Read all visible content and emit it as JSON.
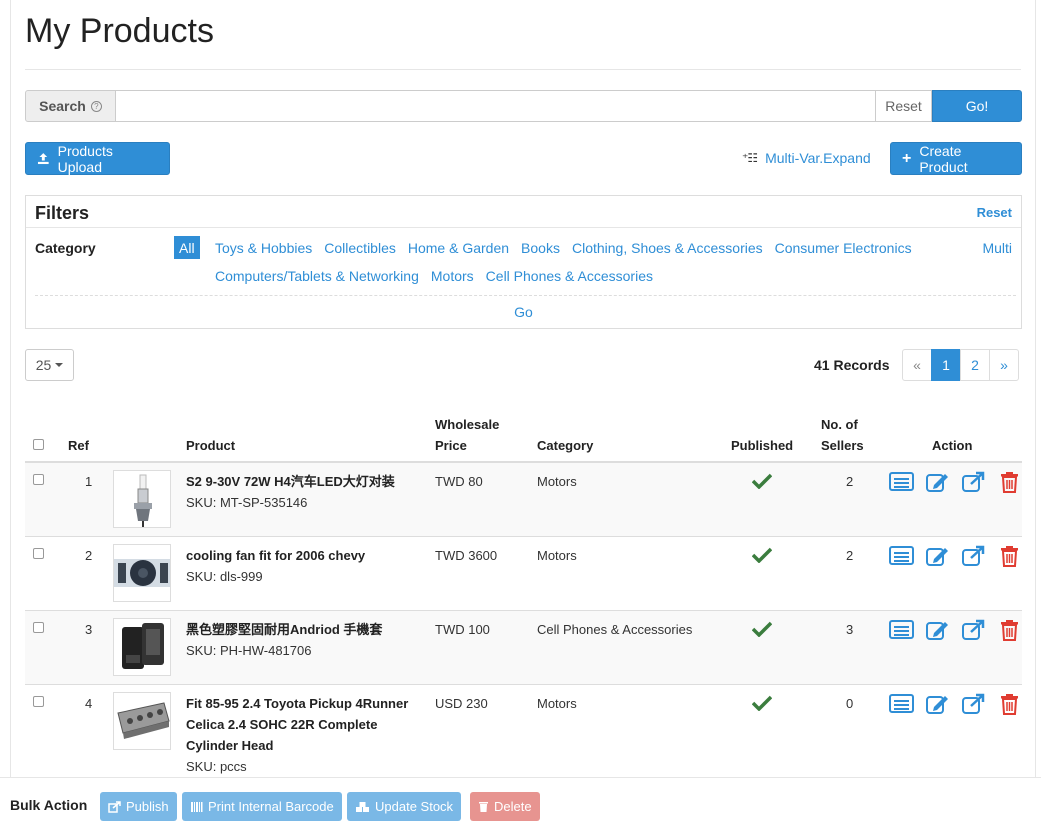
{
  "page": {
    "title": "My Products"
  },
  "search": {
    "label": "Search",
    "help_icon": "question-circle-icon",
    "value": "",
    "placeholder": "",
    "reset_label": "Reset",
    "go_label": "Go!"
  },
  "toolbar": {
    "upload_label": "Products Upload",
    "upload_icon": "upload-icon",
    "multivar_label": "Multi-Var.Expand",
    "multivar_icon": "expand-list-icon",
    "create_label": "Create Product",
    "create_icon": "plus-icon"
  },
  "filters": {
    "title": "Filters",
    "reset_label": "Reset",
    "category_label": "Category",
    "all_label": "All",
    "row1": [
      "Toys & Hobbies",
      "Collectibles",
      "Home & Garden",
      "Books",
      "Clothing, Shoes & Accessories",
      "Consumer Electronics"
    ],
    "row2": [
      "Computers/Tablets & Networking",
      "Motors",
      "Cell Phones & Accessories"
    ],
    "multi_label": "Multi",
    "go_label": "Go"
  },
  "list": {
    "page_size": "25",
    "records_text": "41 Records",
    "pager": [
      "«",
      "1",
      "2",
      "»"
    ],
    "current_page": "1"
  },
  "table": {
    "headers": {
      "ref": "Ref",
      "product": "Product",
      "price_1": "Wholesale",
      "price_2": "Price",
      "category": "Category",
      "published": "Published",
      "sellers_1": "No. of",
      "sellers_2": "Sellers",
      "action": "Action"
    },
    "rows": [
      {
        "ref": "1",
        "name": "S2 9-30V 72W H4汽车LED大灯对装",
        "sku": "SKU: MT-SP-535146",
        "price": "TWD 80",
        "category": "Motors",
        "published": true,
        "sellers": "2"
      },
      {
        "ref": "2",
        "name": "cooling fan fit for 2006 chevy",
        "sku": "SKU: dls-999",
        "price": "TWD 3600",
        "category": "Motors",
        "published": true,
        "sellers": "2"
      },
      {
        "ref": "3",
        "name": "黑色塑膠堅固耐用Andriod 手機套",
        "sku": "SKU: PH-HW-481706",
        "price": "TWD 100",
        "category": "Cell Phones & Accessories",
        "published": true,
        "sellers": "3"
      },
      {
        "ref": "4",
        "name": "Fit 85-95 2.4 Toyota Pickup 4Runner Celica 2.4 SOHC 22R Complete Cylinder Head",
        "sku": "SKU: pccs",
        "price": "USD 230",
        "category": "Motors",
        "published": true,
        "sellers": "0"
      }
    ],
    "action_icons": [
      "list-view-icon",
      "edit-icon",
      "open-external-icon",
      "trash-icon"
    ]
  },
  "bulk": {
    "label": "Bulk Action",
    "publish_label": "Publish",
    "print_label": "Print Internal Barcode",
    "stock_label": "Update Stock",
    "delete_label": "Delete"
  },
  "colors": {
    "primary": "#2f8ed6",
    "check_green": "#3b7d3e",
    "delete_red": "#e03c31",
    "disabled_blue": "#7ab8e6",
    "disabled_red": "#e79490"
  }
}
